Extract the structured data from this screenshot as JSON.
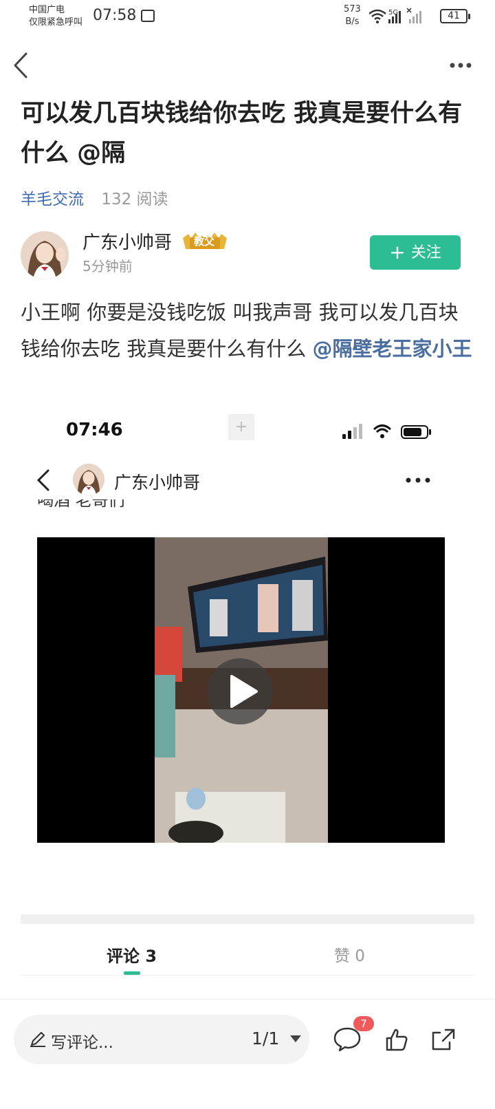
{
  "status_bar": {
    "carrier_line1": "中国广电",
    "carrier_line2": "仅限紧急呼叫",
    "time": "07:58",
    "net_speed_value": "573",
    "net_speed_unit": "B/s",
    "network_label": "5G",
    "battery": "41"
  },
  "nav": {
    "back_icon": "chevron-left-icon",
    "more_icon": "more-horizontal-icon"
  },
  "post": {
    "title": "可以发几百块钱给你去吃 我真是要什么有什么 @隔",
    "tag": "羊毛交流",
    "reads": "132 阅读",
    "author": {
      "name": "广东小帅哥",
      "badge": "教父",
      "time": "5分钟前",
      "follow_label": "关注"
    },
    "body_text": "小王啊 你要是没钱吃饭 叫我声哥 我可以发几百块钱给你去吃  我真是要什么有什么 ",
    "body_mention": "@隔壁老王家小王"
  },
  "embedded_screenshot": {
    "time": "07:46",
    "plus": "+",
    "author_name": "广东小帅哥",
    "cut_text": "喝酒 老哥们"
  },
  "tabs": {
    "comments_label": "评论 3",
    "likes_label": "赞 0"
  },
  "bottom_bar": {
    "comment_placeholder": "写评论...",
    "page": "1/1",
    "comment_count": "7"
  },
  "colors": {
    "accent_green": "#2dbd95",
    "tag_blue": "#3e6bb2",
    "mention_blue": "#4b6ea0",
    "badge_red": "#f05a5a"
  }
}
